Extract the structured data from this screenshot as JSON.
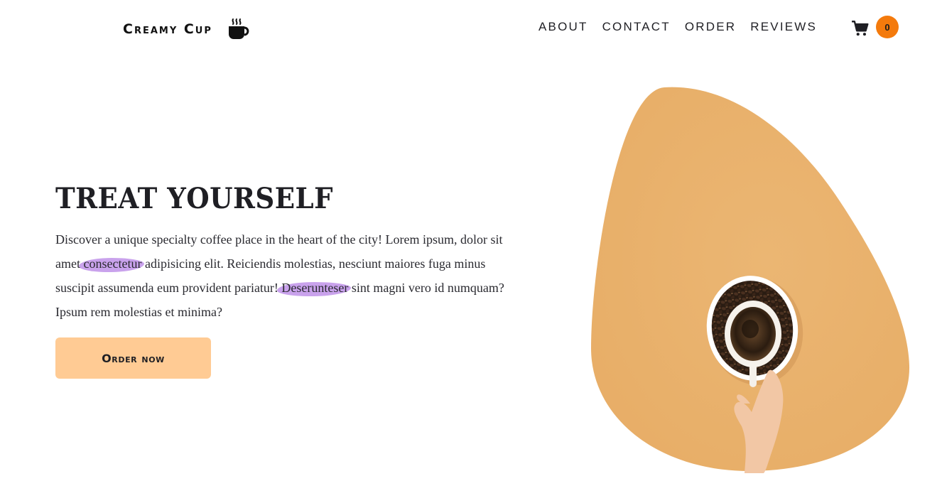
{
  "header": {
    "logo_text": "Creamy Cup",
    "logo_icon": "coffee-cup-icon",
    "nav": [
      {
        "label": "ABOUT"
      },
      {
        "label": "CONTACT"
      },
      {
        "label": "ORDER"
      },
      {
        "label": "REVIEWS"
      }
    ],
    "cart_icon": "shopping-cart-icon",
    "cart_count": "0"
  },
  "hero": {
    "title": "TREAT YOURSELF",
    "body": {
      "part1": "Discover a unique specialty coffee place in the heart of the city! Lorem ipsum, dolor sit amet ",
      "highlight1": "consectetur",
      "part2": " adipisicing elit. Reiciendis molestias, nesciunt maiores fuga minus suscipit assumenda eum provident pariatur! ",
      "highlight2": "Deserunteser",
      "part3": " sint magni vero id numquam? Ipsum rem molestias et minima?"
    },
    "button_label": "Order now",
    "image": "coffee-cup-on-beans-image"
  },
  "colors": {
    "accent": "#f47a0c",
    "button": "#ffcb94",
    "highlight": "#c9a2ec",
    "blob": "#ebb673"
  }
}
